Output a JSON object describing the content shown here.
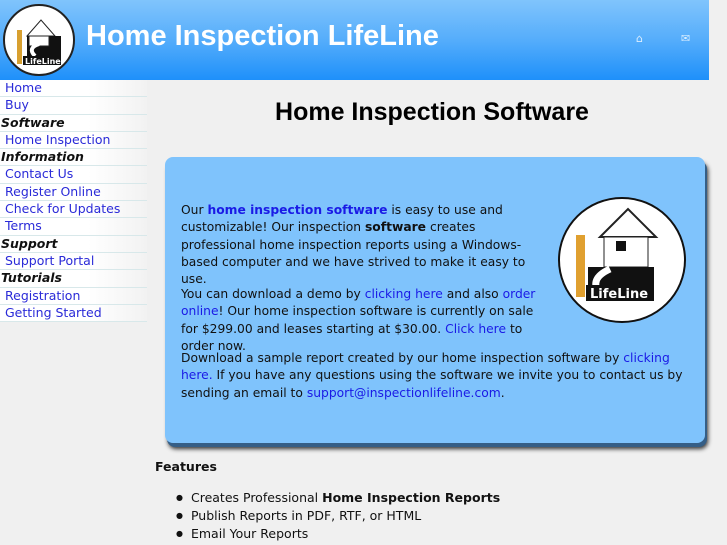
{
  "header": {
    "title": "Home Inspection LifeLine",
    "logo_text": "LifeLine",
    "icons": [
      "home-icon",
      "mail-icon"
    ]
  },
  "sidebar": {
    "items": [
      {
        "label": "Home",
        "type": "link"
      },
      {
        "label": "Buy",
        "type": "link"
      },
      {
        "label": "Software",
        "type": "heading"
      },
      {
        "label": "Home Inspection",
        "type": "link"
      },
      {
        "label": "Information",
        "type": "heading"
      },
      {
        "label": "Contact Us",
        "type": "link"
      },
      {
        "label": "Register Online",
        "type": "link"
      },
      {
        "label": "Check for Updates",
        "type": "link"
      },
      {
        "label": "Terms",
        "type": "link"
      },
      {
        "label": "Support",
        "type": "heading"
      },
      {
        "label": "Support Portal",
        "type": "link"
      },
      {
        "label": "Tutorials",
        "type": "heading"
      },
      {
        "label": "Registration",
        "type": "link"
      },
      {
        "label": "Getting Started",
        "type": "link"
      }
    ]
  },
  "main": {
    "title": "Home Inspection Software",
    "p1": {
      "a": "Our ",
      "link": "home inspection software",
      "b": " is easy to use and customizable! Our inspection ",
      "bold": "software",
      "c": " creates professional home inspection reports using a Windows-based computer and we have strived to make it easy to use."
    },
    "p2": {
      "a": "You can download a demo by ",
      "link1": "clicking here",
      "b": " and also ",
      "link2": "order online",
      "c": "! Our home inspection software is currently on sale for $299.00 and leases starting at $30.00. ",
      "link3": "Click here",
      "d": " to order now."
    },
    "p3": {
      "a": "Download a sample report created by our home inspection software by ",
      "link1": "clicking here.",
      "b": " If you have any questions using the software we invite you to contact us by sending an email to ",
      "link2": "support@inspectionlifeline.com",
      "c": "."
    },
    "logo_text": "LifeLine",
    "features_title": "Features",
    "features": [
      {
        "a": "Creates Professional ",
        "bold": "Home Inspection Reports"
      },
      {
        "a": "Publish Reports in PDF, RTF, or HTML"
      },
      {
        "a": "Email Your Reports"
      }
    ]
  }
}
